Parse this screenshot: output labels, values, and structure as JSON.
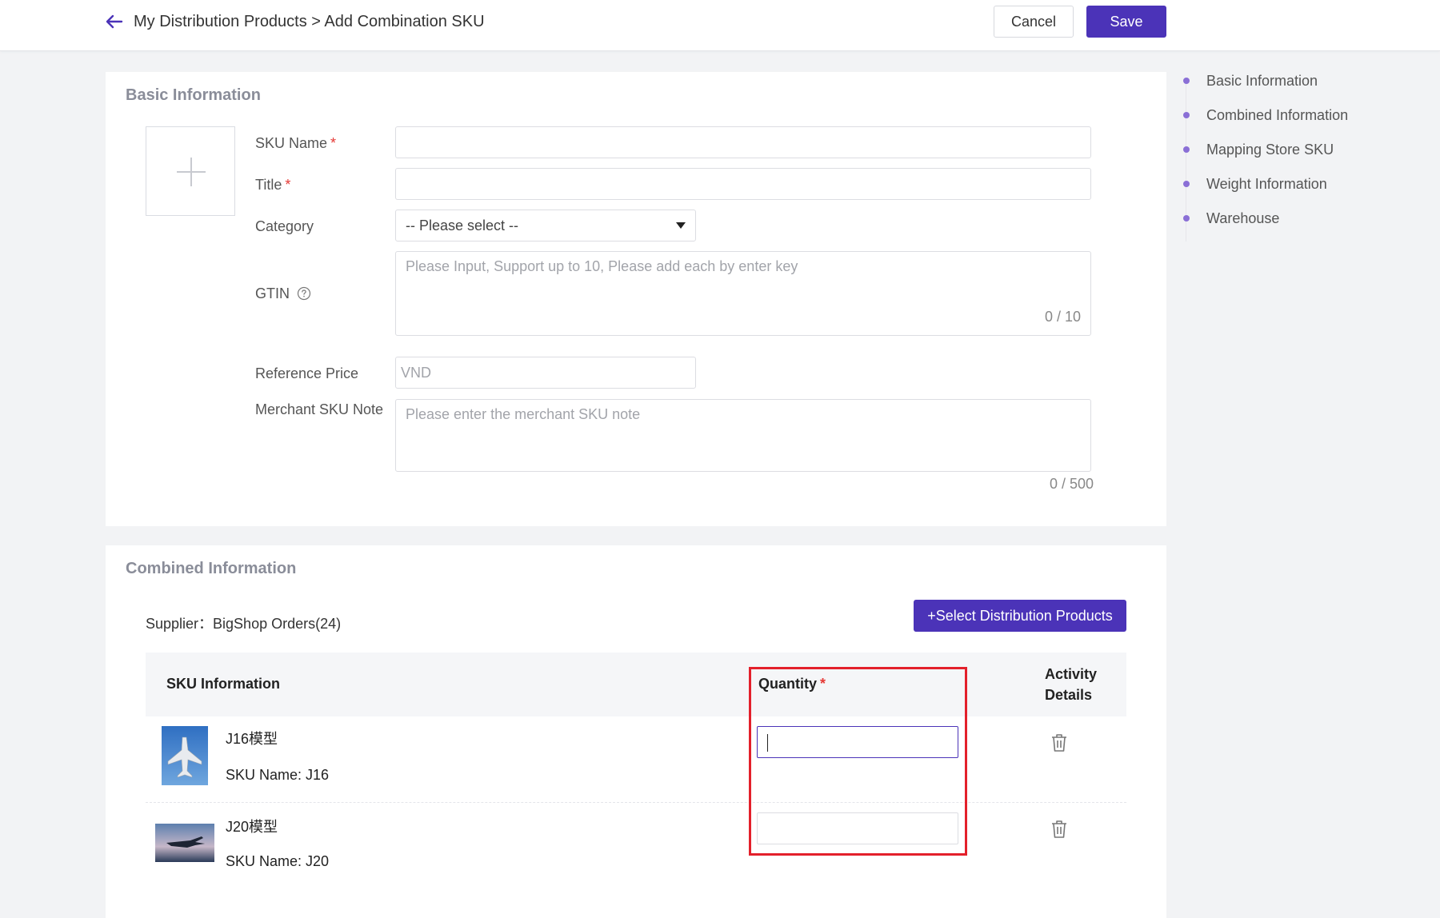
{
  "header": {
    "breadcrumb": "My Distribution Products > Add Combination SKU",
    "cancel_label": "Cancel",
    "save_label": "Save",
    "accent_color": "#4b33b8"
  },
  "basic_info": {
    "title": "Basic Information",
    "sku_name_label": "SKU Name",
    "title_label": "Title",
    "category_label": "Category",
    "category_value": "-- Please select --",
    "gtin_label": "GTIN",
    "gtin_placeholder": "Please Input, Support up to 10, Please add each by enter key",
    "gtin_count": "0 / 10",
    "reference_price_label": "Reference Price",
    "reference_price_placeholder": "VND",
    "merchant_note_label": "Merchant SKU Note",
    "merchant_note_placeholder": "Please enter the merchant SKU note",
    "merchant_note_count": "0 / 500",
    "required_mark": "*"
  },
  "combined_info": {
    "title": "Combined Information",
    "supplier": "Supplier：BigShop Orders(24)",
    "select_button": "+Select Distribution Products",
    "columns": {
      "sku_info": "SKU Information",
      "quantity": "Quantity",
      "activity_line1": "Activity",
      "activity_line2": "Details"
    },
    "rows": [
      {
        "name": "J16模型",
        "sku_name": "SKU Name: J16",
        "quantity": ""
      },
      {
        "name": "J20模型",
        "sku_name": "SKU Name: J20",
        "quantity": ""
      }
    ]
  },
  "anchor_nav": {
    "items": [
      "Basic Information",
      "Combined Information",
      "Mapping Store SKU",
      "Weight Information",
      "Warehouse"
    ]
  }
}
